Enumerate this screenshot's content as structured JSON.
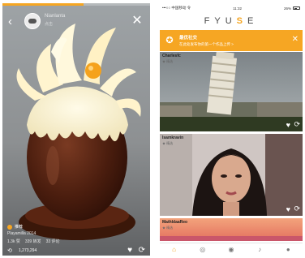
{
  "left": {
    "progress": 0.55,
    "user": {
      "name": "Nianlanta",
      "subtitle": "点击"
    },
    "category": "推荐",
    "caption": "Playamilla 2014",
    "stats": [
      "1.3k 赞",
      "339 转发",
      "33 评论"
    ],
    "views": "1,273,294",
    "icons": {
      "back": "back-arrow-icon",
      "close": "close-icon",
      "heart": "heart-icon",
      "share": "repeat-icon"
    }
  },
  "right": {
    "status": {
      "carrier": "•••○○ 中国移动 令",
      "time": "11:32",
      "battery": "26%"
    },
    "brand": {
      "before": "FYU",
      "highlight": "S",
      "after": "E"
    },
    "banner": {
      "title": "最优社交",
      "subtitle": "在此处发布你的第一个作品上传 >",
      "icon": "badge-icon"
    },
    "cards": [
      {
        "user": "Charlesfc",
        "tag": "★ 精选"
      },
      {
        "user": "Isamkravin",
        "tag": "★ 精选"
      },
      {
        "user": "MathldaaReo",
        "tag": "★ 精选"
      }
    ],
    "tabs": [
      {
        "name": "home-icon",
        "glyph": "⌂",
        "active": true
      },
      {
        "name": "compass-icon",
        "glyph": "◎",
        "active": false
      },
      {
        "name": "camera-icon",
        "glyph": "◉",
        "active": false
      },
      {
        "name": "bell-icon",
        "glyph": "♪",
        "active": false
      },
      {
        "name": "profile-icon",
        "glyph": "●",
        "active": false
      }
    ]
  },
  "colors": {
    "accent": "#f6a623"
  }
}
